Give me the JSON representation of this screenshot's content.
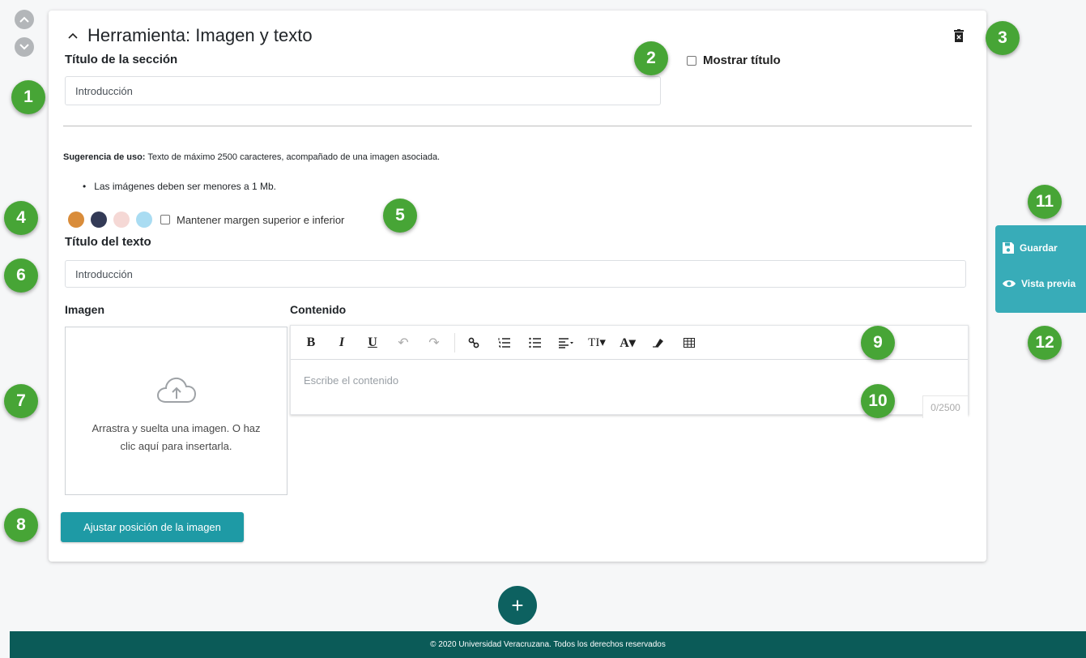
{
  "tool": {
    "title": "Herramienta: Imagen y texto",
    "section_title_label": "Título de la sección",
    "section_title_value": "Introducción",
    "show_title_label": "Mostrar título",
    "hint_bold": "Sugerencia de uso:",
    "hint_text": " Texto de máximo 2500 caracteres, acompañado de una imagen asociada.",
    "bullet": "Las imágenes deben ser menores a 1 Mb.",
    "swatches": [
      "#d98c3a",
      "#333a56",
      "#f5d8d5",
      "#a9dcf2"
    ],
    "margin_label": "Mantener margen superior e inferior",
    "text_title_label": "Título del texto",
    "text_title_value": "Introducción",
    "image_label": "Imagen",
    "content_label": "Contenido",
    "upload_text": "Arrastra y suelta una imagen. O haz clic aquí para insertarla.",
    "editor_placeholder": "Escribe el contenido",
    "counter": "0/2500",
    "adjust_button": "Ajustar posición de la imagen"
  },
  "toolbar": {
    "bold": "B",
    "italic": "I",
    "underline": "U",
    "undo": "↶",
    "redo": "↷",
    "link": "🔗",
    "ordered_list": "≡",
    "unordered_list": "≡",
    "align": "≡▾",
    "text_size": "TI▾",
    "font_color": "A▾",
    "eraser": "⌫",
    "table": "⊞"
  },
  "side": {
    "save": "Guardar",
    "preview": "Vista previa"
  },
  "badges": [
    "1",
    "2",
    "3",
    "4",
    "5",
    "6",
    "7",
    "8",
    "9",
    "10",
    "11",
    "12"
  ],
  "footer": "© 2020 Universidad Veracruzana. Todos los derechos reservados",
  "add_button": "+",
  "colors": {
    "accent": "#1e9aa5",
    "side_panel": "#38acb8",
    "badge": "#47a536",
    "footer": "#0b5b58"
  }
}
